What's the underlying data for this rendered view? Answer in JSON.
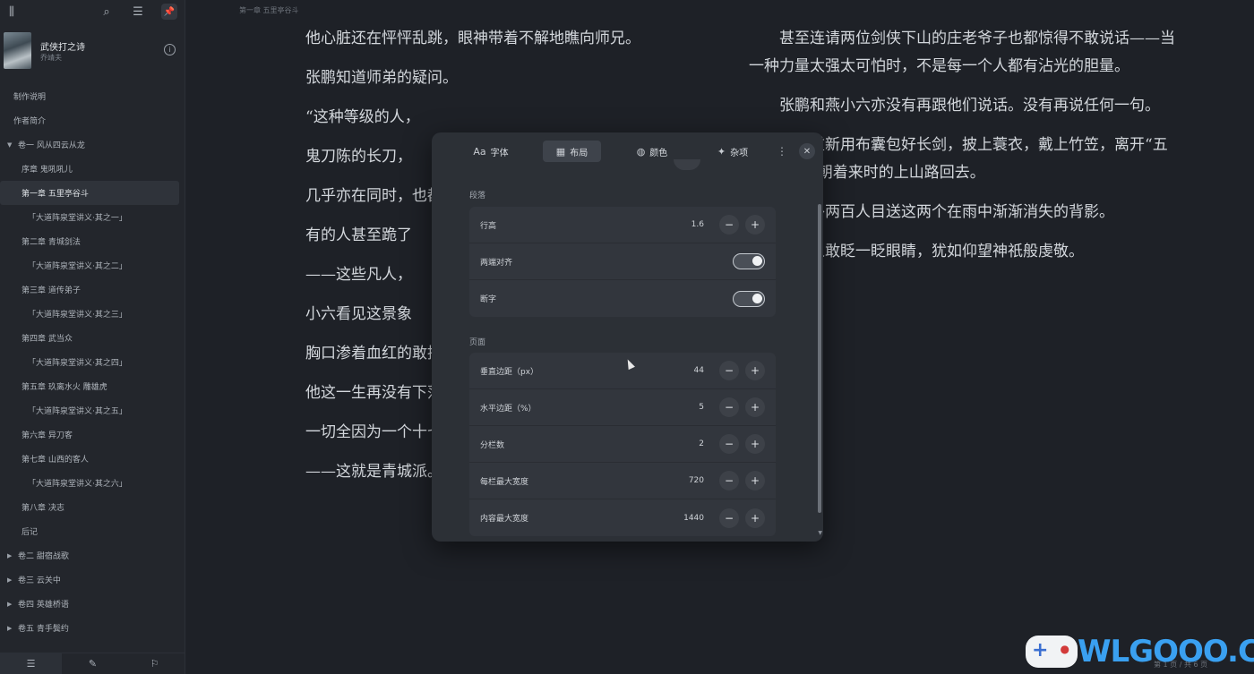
{
  "sidebar": {
    "book_title": "武侠打之诗",
    "book_author": "乔靖夫",
    "toc": [
      {
        "label": "制作说明",
        "level": 0
      },
      {
        "label": "作者简介",
        "level": 0
      },
      {
        "label": "卷一 风从四云从龙",
        "level": "vol",
        "expanded": true
      },
      {
        "label": "序章 鬼吼吼儿",
        "level": 1
      },
      {
        "label": "第一章 五里亭谷斗",
        "level": 1,
        "active": true
      },
      {
        "label": "「大道阵泉堂讲义·其之一」",
        "level": 2
      },
      {
        "label": "第二章 青城剑法",
        "level": 1
      },
      {
        "label": "「大道阵泉堂讲义·其之二」",
        "level": 2
      },
      {
        "label": "第三章 道传弟子",
        "level": 1
      },
      {
        "label": "「大道阵泉堂讲义·其之三」",
        "level": 2
      },
      {
        "label": "第四章 武当众",
        "level": 1
      },
      {
        "label": "「大道阵泉堂讲义·其之四」",
        "level": 2
      },
      {
        "label": "第五章 玖离水火 雕雄虎",
        "level": 1
      },
      {
        "label": "「大道阵泉堂讲义·其之五」",
        "level": 2
      },
      {
        "label": "第六章 异刀客",
        "level": 1
      },
      {
        "label": "第七章 山西的客人",
        "level": 1
      },
      {
        "label": "「大道阵泉堂讲义·其之六」",
        "level": 2
      },
      {
        "label": "第八章 决志",
        "level": 1
      },
      {
        "label": "后记",
        "level": 1
      },
      {
        "label": "卷二 甜宿战歌",
        "level": "vol"
      },
      {
        "label": "卷三 云关中",
        "level": "vol"
      },
      {
        "label": "卷四 英雄桥语",
        "level": "vol"
      },
      {
        "label": "卷五 青手鬓约",
        "level": "vol"
      }
    ]
  },
  "reader": {
    "breadcrumb": "第一章 五里亭谷斗",
    "col1": [
      "他心脏还在怦怦乱跳，眼神带着不解地瞧向师兄。",
      "张鹏知道师弟的疑问。",
      "“这种等级的人，",
      "鬼刀陈的长刀，",
      "几乎亦在同时，也都纷纷掉落在泥泞",
      "有的人甚至跪了",
      "——这些凡人，",
      "小六看见这景象",
      "胸口渗着血红的敢抬起来看两个青城",
      "他这一生再没有下落。有传言说是出灌县山岭那伙匪盗，",
      "一切全因为一个十七岁少年的一剑。",
      "——这就是青城派。"
    ],
    "col2": [
      "甚至连请两位剑侠下山的庄老爷子也都惊得不敢说话——当一种力量太强太可怕时，不是每一个人都有沾光的胆量。",
      "张鹏和燕小六亦没有再跟他们说话。没有再说任何一句。",
      "他们重新用布囊包好长剑，披上蓑衣，戴上竹笠，离开“五里望亭”，朝着来时的上山路回去。",
      "亭内外两百人目送这两个在雨中渐渐消失的背影。",
      "没有人敢眨一眨眼睛，犹如仰望神祇般虔敬。"
    ],
    "page_indicator": "第 1 页 / 共 6 页"
  },
  "settings": {
    "tabs": [
      {
        "label": "字体",
        "icon": "font-icon"
      },
      {
        "label": "布局",
        "icon": "layout-icon",
        "active": true
      },
      {
        "label": "颜色",
        "icon": "palette-icon"
      },
      {
        "label": "杂项",
        "icon": "misc-icon"
      }
    ],
    "paragraph_section": "段落",
    "line_height_label": "行高",
    "line_height_value": "1.6",
    "justify_label": "两端对齐",
    "justify_on": true,
    "hyphen_label": "断字",
    "hyphen_on": true,
    "page_section": "页面",
    "vmargin_label": "垂直边距（px）",
    "vmargin_value": "44",
    "hmargin_label": "水平边距（%）",
    "hmargin_value": "5",
    "columns_label": "分栏数",
    "columns_value": "2",
    "col_width_label": "每栏最大宽度",
    "col_width_value": "720",
    "content_width_label": "内容最大宽度",
    "content_width_value": "1440"
  },
  "watermark": {
    "text": "WLGOOO.COM"
  }
}
